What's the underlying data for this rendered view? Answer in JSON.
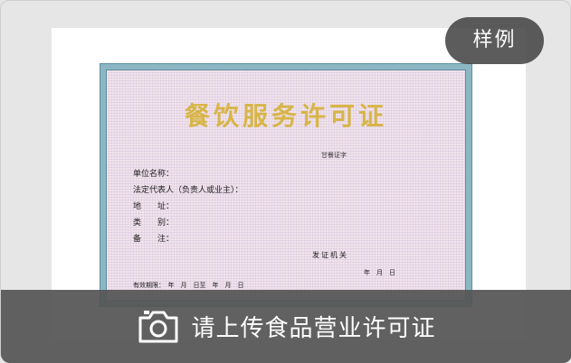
{
  "certificate": {
    "title": "餐饮服务许可证",
    "number_label": "甘餐证字",
    "fields": [
      {
        "label": "单位名称："
      },
      {
        "label": "法定代表人（负责人或业主）："
      },
      {
        "label": "地　　址："
      },
      {
        "label": "类　　别："
      },
      {
        "label": "备　　注："
      }
    ],
    "issuer": "发证机关",
    "issue_date": "年　月　日",
    "valid_period": "有效期限：　年　月　日至　年　月　日"
  },
  "badge": {
    "label": "样例"
  },
  "upload": {
    "label": "请上传食品营业许可证",
    "icon": "camera-icon"
  },
  "colors": {
    "background": "#e6e6e6",
    "certificate_bg": "#f3e3ea",
    "certificate_border": "#8bb7c4",
    "title": "#d7b548",
    "overlay": "#555555"
  }
}
